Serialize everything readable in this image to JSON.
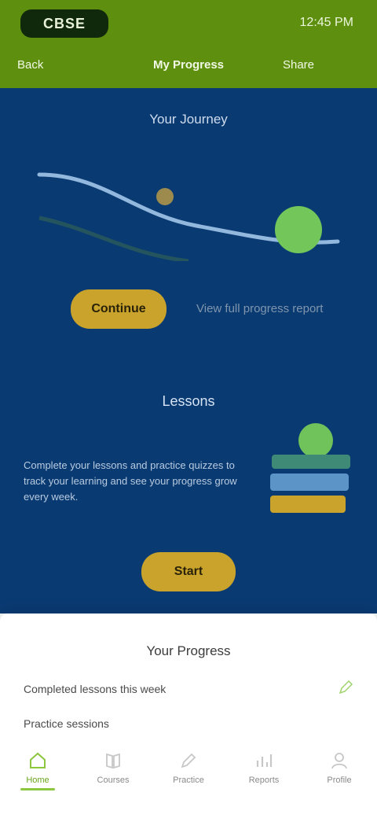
{
  "header": {
    "logo": "CBSE",
    "status": "12:45 PM",
    "nav_left": "Back",
    "nav_title": "My Progress",
    "nav_right": "Share"
  },
  "hero": {
    "heading": "Your Journey",
    "cta_label": "Continue",
    "link_text": "View full progress report"
  },
  "section": {
    "heading": "Lessons",
    "body": "Complete your lessons and practice quizzes to track your learning and see your progress grow every week."
  },
  "cta2_label": "Start",
  "card": {
    "title": "Your Progress",
    "row1": "Completed lessons this week",
    "row2": "Practice sessions"
  },
  "tabs": [
    {
      "label": "Home",
      "icon": "home-icon",
      "active": true
    },
    {
      "label": "Courses",
      "icon": "book-icon",
      "active": false
    },
    {
      "label": "Practice",
      "icon": "pencil-icon",
      "active": false
    },
    {
      "label": "Reports",
      "icon": "chart-icon",
      "active": false
    },
    {
      "label": "Profile",
      "icon": "user-icon",
      "active": false
    }
  ],
  "colors": {
    "header_green": "#5f8f0e",
    "hero_navy": "#0a3a72",
    "accent_gold": "#c9a32b",
    "accent_lime": "#8dc63f"
  }
}
